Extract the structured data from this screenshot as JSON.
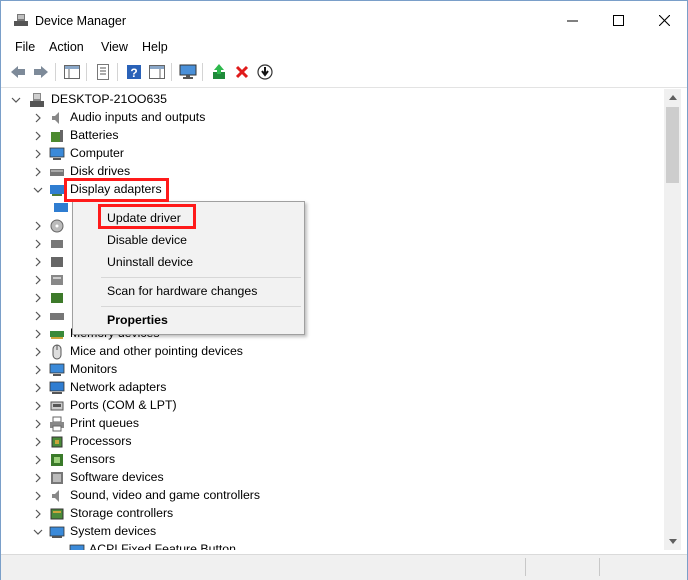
{
  "window": {
    "title": "Device Manager",
    "controls": [
      "minimize",
      "maximize",
      "close"
    ]
  },
  "menubar": [
    "File",
    "Action",
    "View",
    "Help"
  ],
  "toolbar": {
    "icons": [
      "back-arrow-icon",
      "forward-arrow-icon",
      "show-hide-console-tree-icon",
      "properties-icon",
      "help-icon",
      "action-pane-icon",
      "monitor-icon",
      "update-driver-icon",
      "uninstall-icon",
      "disable-icon"
    ]
  },
  "tree": {
    "root": "DESKTOP-21OO635",
    "items": [
      {
        "label": "Audio inputs and outputs",
        "icon": "speaker-icon",
        "expanded": false
      },
      {
        "label": "Batteries",
        "icon": "battery-icon",
        "expanded": false
      },
      {
        "label": "Computer",
        "icon": "computer-icon",
        "expanded": false
      },
      {
        "label": "Disk drives",
        "icon": "disk-icon",
        "expanded": false
      },
      {
        "label": "Display adapters",
        "icon": "display-adapter-icon",
        "expanded": true
      },
      {
        "label": "",
        "icon": "generic-device-icon",
        "expanded": false
      },
      {
        "label": "",
        "icon": "generic-device-icon",
        "expanded": false
      },
      {
        "label": "",
        "icon": "generic-device-icon",
        "expanded": false
      },
      {
        "label": "",
        "icon": "generic-device-icon",
        "expanded": false
      },
      {
        "label": "",
        "icon": "generic-device-icon",
        "expanded": false
      },
      {
        "label": "",
        "icon": "generic-device-icon",
        "expanded": false
      },
      {
        "label": "Memory devices",
        "icon": "memory-icon",
        "expanded": false
      },
      {
        "label": "Mice and other pointing devices",
        "icon": "mouse-icon",
        "expanded": false
      },
      {
        "label": "Monitors",
        "icon": "monitor-icon",
        "expanded": false
      },
      {
        "label": "Network adapters",
        "icon": "network-icon",
        "expanded": false
      },
      {
        "label": "Ports (COM & LPT)",
        "icon": "port-icon",
        "expanded": false
      },
      {
        "label": "Print queues",
        "icon": "printer-icon",
        "expanded": false
      },
      {
        "label": "Processors",
        "icon": "processor-icon",
        "expanded": false
      },
      {
        "label": "Sensors",
        "icon": "sensor-icon",
        "expanded": false
      },
      {
        "label": "Software devices",
        "icon": "software-icon",
        "expanded": false
      },
      {
        "label": "Sound, video and game controllers",
        "icon": "speaker-icon",
        "expanded": false
      },
      {
        "label": "Storage controllers",
        "icon": "storage-icon",
        "expanded": false
      },
      {
        "label": "System devices",
        "icon": "system-icon",
        "expanded": true
      },
      {
        "label": "ACPI Fixed Feature Button",
        "icon": "system-icon",
        "expanded": false
      }
    ]
  },
  "context_menu": {
    "items": [
      "Update driver",
      "Disable device",
      "Uninstall device",
      "Scan for hardware changes",
      "Properties"
    ]
  },
  "colors": {
    "highlight": "#ff1a1a",
    "accent": "#0078d7"
  }
}
